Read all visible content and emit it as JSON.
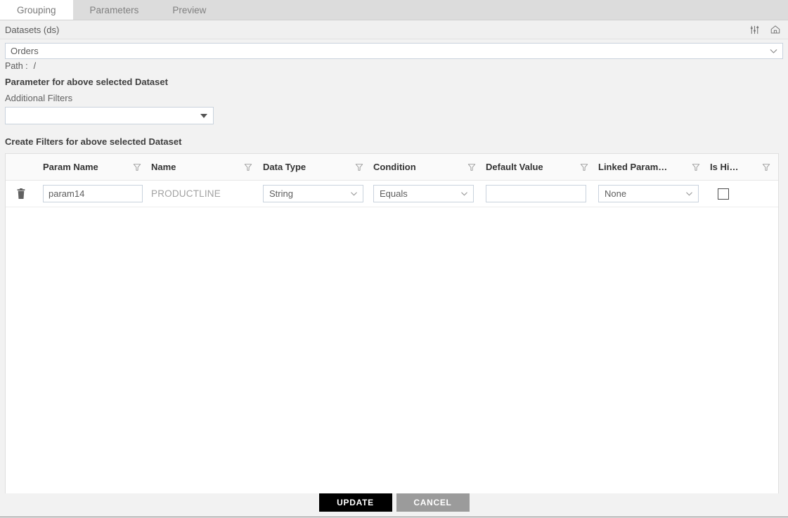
{
  "tabs": [
    {
      "label": "Grouping",
      "active": true
    },
    {
      "label": "Parameters",
      "active": false
    },
    {
      "label": "Preview",
      "active": false
    }
  ],
  "datasets_bar": {
    "label": "Datasets (ds)",
    "sliders_icon": "sliders-icon",
    "home_icon": "home-icon"
  },
  "dataset": {
    "selected": "Orders",
    "chevron_icon": "chevron-down-icon"
  },
  "path": {
    "label": "Path :",
    "value": "/"
  },
  "parameter_section": {
    "heading": "Parameter for above selected Dataset",
    "additional_filters_label": "Additional Filters",
    "additional_filters_value": "",
    "additional_filters_placeholder": "",
    "caret_icon": "caret-down-icon"
  },
  "create_filters": {
    "heading": "Create Filters for above selected Dataset"
  },
  "grid": {
    "columns": [
      {
        "label": "",
        "key": "delete",
        "filterable": false
      },
      {
        "label": "Param Name",
        "key": "param_name",
        "filterable": true
      },
      {
        "label": "Name",
        "key": "name",
        "filterable": true
      },
      {
        "label": "Data Type",
        "key": "data_type",
        "filterable": true
      },
      {
        "label": "Condition",
        "key": "condition",
        "filterable": true
      },
      {
        "label": "Default Value",
        "key": "default_value",
        "filterable": true
      },
      {
        "label": "Linked Param…",
        "key": "linked_param",
        "filterable": true
      },
      {
        "label": "Is Hi…",
        "key": "is_hidden",
        "filterable": true
      }
    ],
    "filter_icon": "funnel-filter-icon",
    "rows": [
      {
        "delete_icon": "trash-icon",
        "param_name": "param14",
        "param_name_placeholder": "",
        "name": "PRODUCTLINE",
        "data_type": "String",
        "condition": "Equals",
        "default_value": "",
        "default_value_placeholder": "",
        "linked_param": "None",
        "is_hidden_checked": false
      }
    ]
  },
  "footer": {
    "update_label": "UPDATE",
    "cancel_label": "CANCEL"
  },
  "colors": {
    "accent": "#000000",
    "secondary": "#9b9b9b",
    "tab_active_bg": "#ffffff",
    "tab_bar_bg": "#dcdcdc",
    "page_bg": "#f2f2f2",
    "field_border": "#c9d2dd"
  }
}
